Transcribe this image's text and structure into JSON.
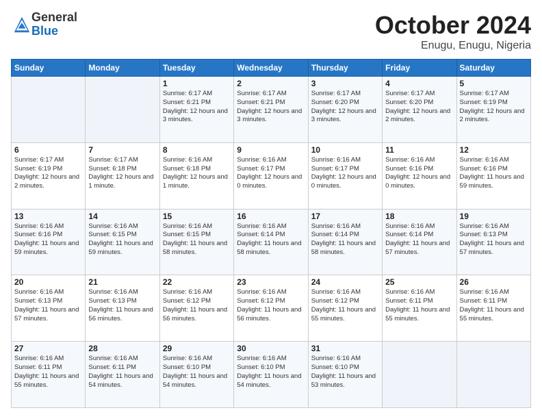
{
  "header": {
    "logo_general": "General",
    "logo_blue": "Blue",
    "month_title": "October 2024",
    "location": "Enugu, Enugu, Nigeria"
  },
  "days_of_week": [
    "Sunday",
    "Monday",
    "Tuesday",
    "Wednesday",
    "Thursday",
    "Friday",
    "Saturday"
  ],
  "weeks": [
    [
      {
        "day": "",
        "info": ""
      },
      {
        "day": "",
        "info": ""
      },
      {
        "day": "1",
        "info": "Sunrise: 6:17 AM\nSunset: 6:21 PM\nDaylight: 12 hours and 3 minutes."
      },
      {
        "day": "2",
        "info": "Sunrise: 6:17 AM\nSunset: 6:21 PM\nDaylight: 12 hours and 3 minutes."
      },
      {
        "day": "3",
        "info": "Sunrise: 6:17 AM\nSunset: 6:20 PM\nDaylight: 12 hours and 3 minutes."
      },
      {
        "day": "4",
        "info": "Sunrise: 6:17 AM\nSunset: 6:20 PM\nDaylight: 12 hours and 2 minutes."
      },
      {
        "day": "5",
        "info": "Sunrise: 6:17 AM\nSunset: 6:19 PM\nDaylight: 12 hours and 2 minutes."
      }
    ],
    [
      {
        "day": "6",
        "info": "Sunrise: 6:17 AM\nSunset: 6:19 PM\nDaylight: 12 hours and 2 minutes."
      },
      {
        "day": "7",
        "info": "Sunrise: 6:17 AM\nSunset: 6:18 PM\nDaylight: 12 hours and 1 minute."
      },
      {
        "day": "8",
        "info": "Sunrise: 6:16 AM\nSunset: 6:18 PM\nDaylight: 12 hours and 1 minute."
      },
      {
        "day": "9",
        "info": "Sunrise: 6:16 AM\nSunset: 6:17 PM\nDaylight: 12 hours and 0 minutes."
      },
      {
        "day": "10",
        "info": "Sunrise: 6:16 AM\nSunset: 6:17 PM\nDaylight: 12 hours and 0 minutes."
      },
      {
        "day": "11",
        "info": "Sunrise: 6:16 AM\nSunset: 6:16 PM\nDaylight: 12 hours and 0 minutes."
      },
      {
        "day": "12",
        "info": "Sunrise: 6:16 AM\nSunset: 6:16 PM\nDaylight: 11 hours and 59 minutes."
      }
    ],
    [
      {
        "day": "13",
        "info": "Sunrise: 6:16 AM\nSunset: 6:16 PM\nDaylight: 11 hours and 59 minutes."
      },
      {
        "day": "14",
        "info": "Sunrise: 6:16 AM\nSunset: 6:15 PM\nDaylight: 11 hours and 59 minutes."
      },
      {
        "day": "15",
        "info": "Sunrise: 6:16 AM\nSunset: 6:15 PM\nDaylight: 11 hours and 58 minutes."
      },
      {
        "day": "16",
        "info": "Sunrise: 6:16 AM\nSunset: 6:14 PM\nDaylight: 11 hours and 58 minutes."
      },
      {
        "day": "17",
        "info": "Sunrise: 6:16 AM\nSunset: 6:14 PM\nDaylight: 11 hours and 58 minutes."
      },
      {
        "day": "18",
        "info": "Sunrise: 6:16 AM\nSunset: 6:14 PM\nDaylight: 11 hours and 57 minutes."
      },
      {
        "day": "19",
        "info": "Sunrise: 6:16 AM\nSunset: 6:13 PM\nDaylight: 11 hours and 57 minutes."
      }
    ],
    [
      {
        "day": "20",
        "info": "Sunrise: 6:16 AM\nSunset: 6:13 PM\nDaylight: 11 hours and 57 minutes."
      },
      {
        "day": "21",
        "info": "Sunrise: 6:16 AM\nSunset: 6:13 PM\nDaylight: 11 hours and 56 minutes."
      },
      {
        "day": "22",
        "info": "Sunrise: 6:16 AM\nSunset: 6:12 PM\nDaylight: 11 hours and 56 minutes."
      },
      {
        "day": "23",
        "info": "Sunrise: 6:16 AM\nSunset: 6:12 PM\nDaylight: 11 hours and 56 minutes."
      },
      {
        "day": "24",
        "info": "Sunrise: 6:16 AM\nSunset: 6:12 PM\nDaylight: 11 hours and 55 minutes."
      },
      {
        "day": "25",
        "info": "Sunrise: 6:16 AM\nSunset: 6:11 PM\nDaylight: 11 hours and 55 minutes."
      },
      {
        "day": "26",
        "info": "Sunrise: 6:16 AM\nSunset: 6:11 PM\nDaylight: 11 hours and 55 minutes."
      }
    ],
    [
      {
        "day": "27",
        "info": "Sunrise: 6:16 AM\nSunset: 6:11 PM\nDaylight: 11 hours and 55 minutes."
      },
      {
        "day": "28",
        "info": "Sunrise: 6:16 AM\nSunset: 6:11 PM\nDaylight: 11 hours and 54 minutes."
      },
      {
        "day": "29",
        "info": "Sunrise: 6:16 AM\nSunset: 6:10 PM\nDaylight: 11 hours and 54 minutes."
      },
      {
        "day": "30",
        "info": "Sunrise: 6:16 AM\nSunset: 6:10 PM\nDaylight: 11 hours and 54 minutes."
      },
      {
        "day": "31",
        "info": "Sunrise: 6:16 AM\nSunset: 6:10 PM\nDaylight: 11 hours and 53 minutes."
      },
      {
        "day": "",
        "info": ""
      },
      {
        "day": "",
        "info": ""
      }
    ]
  ]
}
